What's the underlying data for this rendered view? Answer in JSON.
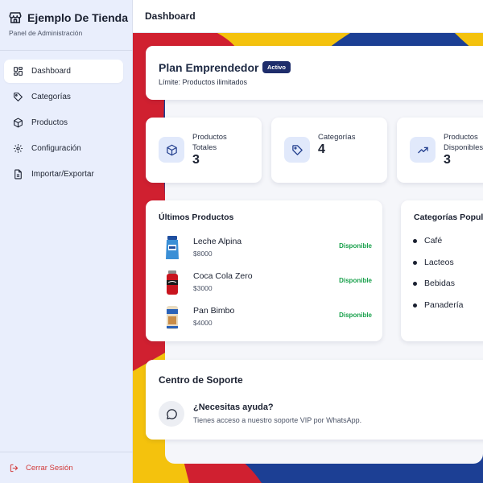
{
  "sidebar": {
    "store_name": "Ejemplo De Tienda",
    "subtitle": "Panel de Administración",
    "items": [
      {
        "label": "Dashboard",
        "icon": "dashboard-grid-icon",
        "active": true
      },
      {
        "label": "Categorías",
        "icon": "tag-icon",
        "active": false
      },
      {
        "label": "Productos",
        "icon": "box-icon",
        "active": false
      },
      {
        "label": "Configuración",
        "icon": "gear-icon",
        "active": false
      },
      {
        "label": "Importar/Exportar",
        "icon": "file-icon",
        "active": false
      }
    ],
    "logout_label": "Cerrar Sesión"
  },
  "header": {
    "title": "Dashboard"
  },
  "plan": {
    "title": "Plan Emprendedor",
    "badge": "Activo",
    "limit": "Límite: Productos ilimitados"
  },
  "stats": [
    {
      "label": "Productos Totales",
      "value": "3",
      "icon": "box-icon"
    },
    {
      "label": "Categorías",
      "value": "4",
      "icon": "tag-icon"
    },
    {
      "label": "Productos Disponibles",
      "value": "3",
      "icon": "trend-up-icon"
    }
  ],
  "products_section": {
    "title": "Últimos Productos",
    "items": [
      {
        "name": "Leche Alpina",
        "price": "$8000",
        "status": "Disponible"
      },
      {
        "name": "Coca Cola Zero",
        "price": "$3000",
        "status": "Disponible"
      },
      {
        "name": "Pan Bimbo",
        "price": "$4000",
        "status": "Disponible"
      }
    ]
  },
  "categories_section": {
    "title": "Categorías Populares",
    "items": [
      "Café",
      "Lacteos",
      "Bebidas",
      "Panadería"
    ]
  },
  "support": {
    "title": "Centro de Soporte",
    "question": "¿Necesitas ayuda?",
    "text": "Tienes acceso a nuestro soporte VIP por WhatsApp."
  },
  "colors": {
    "accent": "#1e2d6b",
    "available": "#18a04b",
    "logout": "#d23a3a",
    "sidebar_bg": "#e9eefc"
  }
}
